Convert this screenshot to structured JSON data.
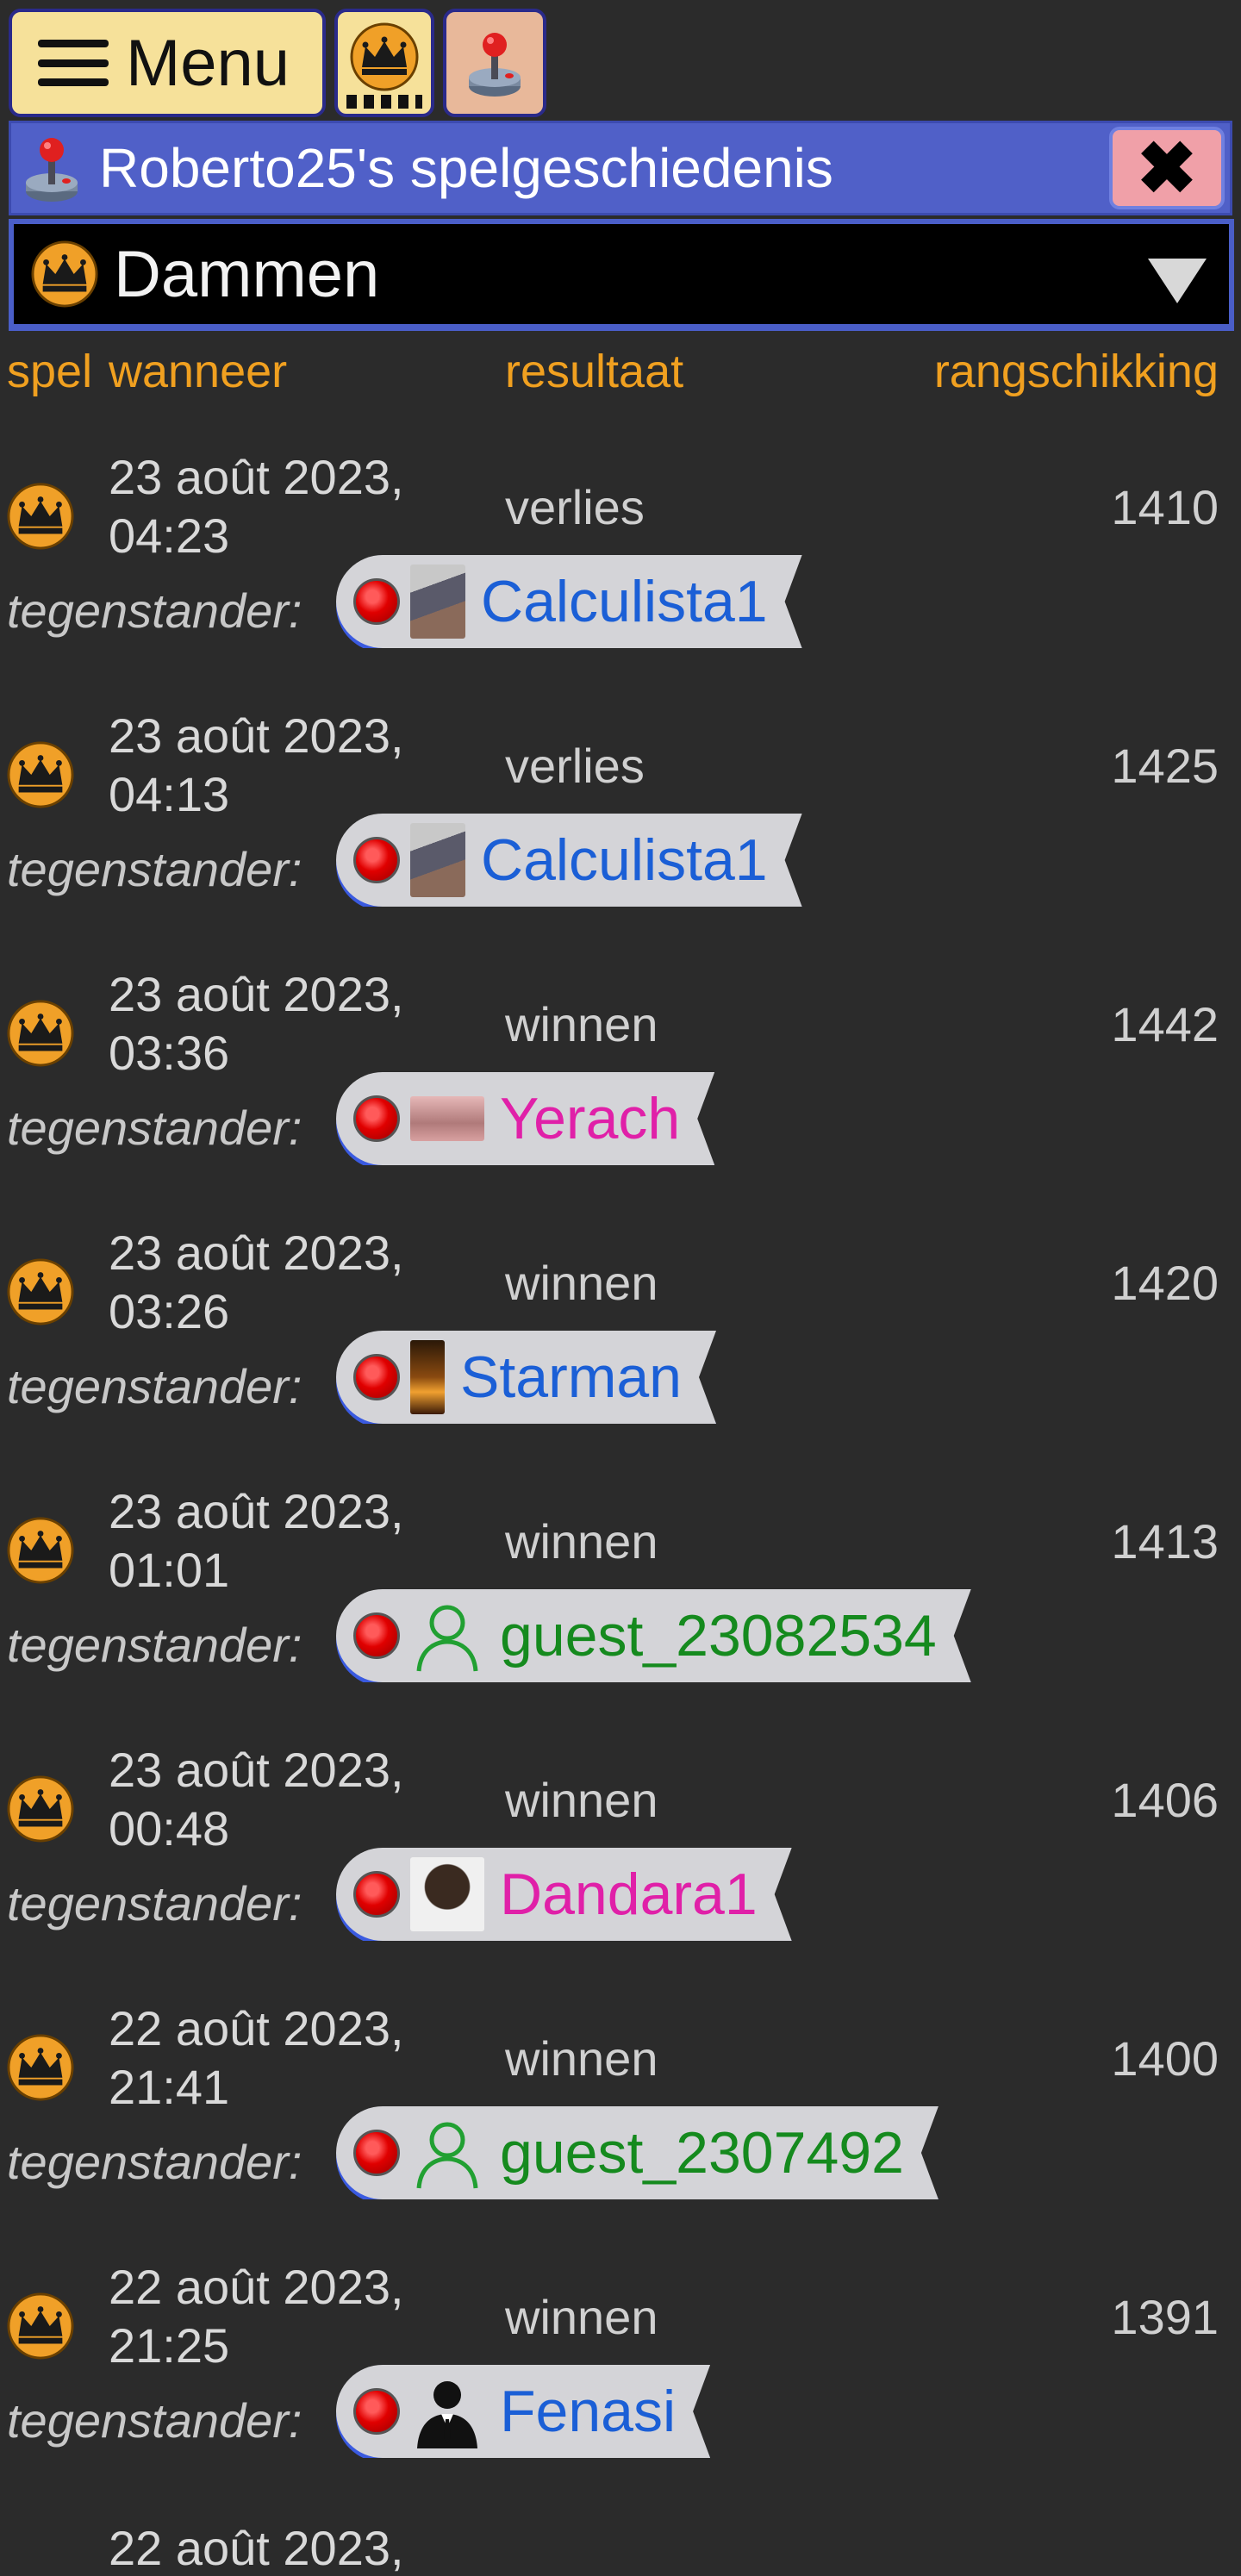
{
  "toolbar": {
    "menu_label": "Menu",
    "menu_icon": "hamburger-icon",
    "crown_icon": "crown-icon",
    "joystick_icon": "joystick-icon"
  },
  "title": {
    "text": "Roberto25's spelgeschiedenis",
    "close_symbol": "✖"
  },
  "selector": {
    "value": "Dammen"
  },
  "table": {
    "headers": {
      "game": "spel",
      "when": "wanneer",
      "result": "resultaat",
      "rank": "rangschikking"
    },
    "opponent_label": "tegenstander:",
    "rows": [
      {
        "date": "23 août 2023,",
        "time": "04:23",
        "result": "verlies",
        "rank": "1410",
        "opponent": "Calculista1",
        "opponent_color": "#1b5fd6",
        "avatar": "photo1"
      },
      {
        "date": "23 août 2023,",
        "time": "04:13",
        "result": "verlies",
        "rank": "1425",
        "opponent": "Calculista1",
        "opponent_color": "#1b5fd6",
        "avatar": "photo1"
      },
      {
        "date": "23 août 2023,",
        "time": "03:36",
        "result": "winnen",
        "rank": "1442",
        "opponent": "Yerach",
        "opponent_color": "#e020a8",
        "avatar": "photo2"
      },
      {
        "date": "23 août 2023,",
        "time": "03:26",
        "result": "winnen",
        "rank": "1420",
        "opponent": "Starman",
        "opponent_color": "#1b5fd6",
        "avatar": "photo3"
      },
      {
        "date": "23 août 2023,",
        "time": "01:01",
        "result": "winnen",
        "rank": "1413",
        "opponent": "guest_23082534",
        "opponent_color": "#158a1e",
        "avatar": "guest"
      },
      {
        "date": "23 août 2023,",
        "time": "00:48",
        "result": "winnen",
        "rank": "1406",
        "opponent": "Dandara1",
        "opponent_color": "#e020a8",
        "avatar": "photo4"
      },
      {
        "date": "22 août 2023,",
        "time": "21:41",
        "result": "winnen",
        "rank": "1400",
        "opponent": "guest_2307492",
        "opponent_color": "#158a1e",
        "avatar": "guest"
      },
      {
        "date": "22 août 2023,",
        "time": "21:25",
        "result": "winnen",
        "rank": "1391",
        "opponent": "Fenasi",
        "opponent_color": "#1b5fd6",
        "avatar": "suit"
      }
    ],
    "partial_next_row": "22 août 2023,"
  }
}
